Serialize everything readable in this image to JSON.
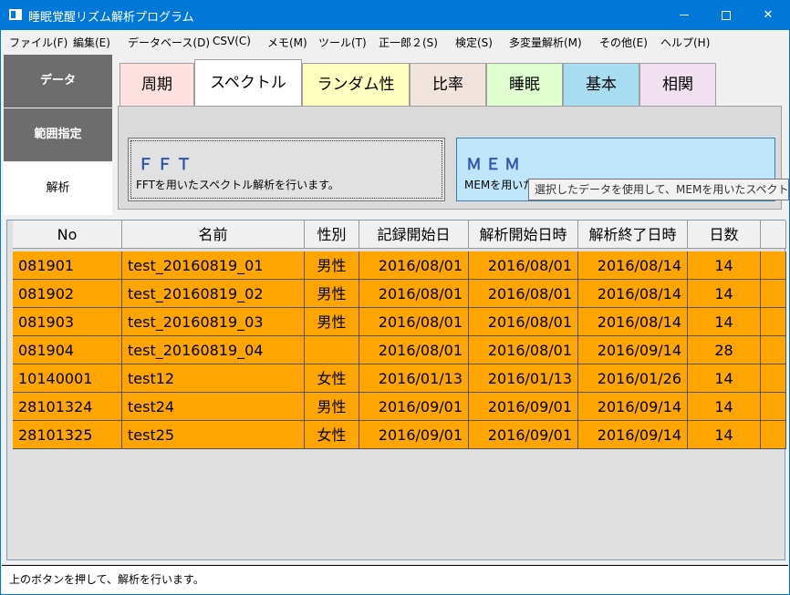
{
  "window": {
    "title": "睡眠覚醒リズム解析プログラム"
  },
  "menu": [
    "ファイル(F)",
    "編集(E)",
    "データベース(D)",
    "CSV(C)",
    "メモ(M)",
    "ツール(T)",
    "正一郎２(S)",
    "検定(S)",
    "多変量解析(M)",
    "その他(E)",
    "ヘルプ(H)"
  ],
  "left_tabs": {
    "data": "データ",
    "range": "範囲指定",
    "analysis": "解析"
  },
  "tabs": [
    {
      "label": "周期",
      "color": "#ffe0e0"
    },
    {
      "label": "スペクトル",
      "color": "#ffffff"
    },
    {
      "label": "ランダム性",
      "color": "#ffffc0"
    },
    {
      "label": "比率",
      "color": "#f0e4dc"
    },
    {
      "label": "睡眠",
      "color": "#e0ffd0"
    },
    {
      "label": "基本",
      "color": "#a8dcf0"
    },
    {
      "label": "相関",
      "color": "#f0e0f0"
    }
  ],
  "fft": {
    "title": "ＦＦＴ",
    "desc": "FFTを用いたスペクトル解析を行います。"
  },
  "mem": {
    "title": "ＭＥＭ",
    "desc": "MEMを用いたスペクトル解析を行います。"
  },
  "tooltip": "選択したデータを使用して、MEMを用いたスペクトル解析を行います。",
  "table": {
    "headers": [
      "No",
      "名前",
      "性別",
      "記録開始日",
      "解析開始日時",
      "解析終了日時",
      "日数"
    ],
    "rows": [
      [
        "081901",
        "test_20160819_01",
        "男性",
        "2016/08/01",
        "2016/08/01",
        "2016/08/14",
        "14"
      ],
      [
        "081902",
        "test_20160819_02",
        "男性",
        "2016/08/01",
        "2016/08/01",
        "2016/08/14",
        "14"
      ],
      [
        "081903",
        "test_20160819_03",
        "男性",
        "2016/08/01",
        "2016/08/01",
        "2016/08/14",
        "14"
      ],
      [
        "081904",
        "test_20160819_04",
        "",
        "2016/08/01",
        "2016/08/01",
        "2016/09/14",
        "28"
      ],
      [
        "10140001",
        "test12",
        "女性",
        "2016/01/13",
        "2016/01/13",
        "2016/01/26",
        "14"
      ],
      [
        "28101324",
        "test24",
        "男性",
        "2016/09/01",
        "2016/09/01",
        "2016/09/14",
        "14"
      ],
      [
        "28101325",
        "test25",
        "女性",
        "2016/09/01",
        "2016/09/01",
        "2016/09/14",
        "14"
      ]
    ]
  },
  "status": "上のボタンを押して、解析を行います。"
}
